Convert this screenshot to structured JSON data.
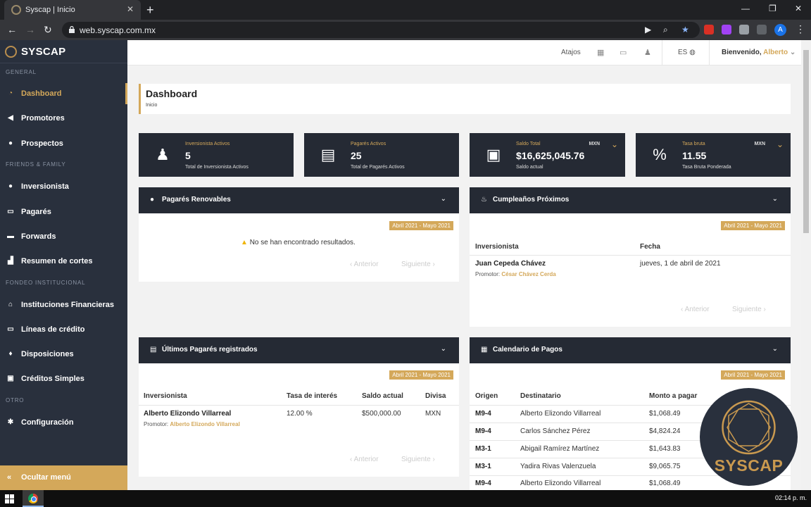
{
  "browser": {
    "tab_title": "Syscap | Inicio",
    "url": "web.syscap.com.mx",
    "profile_initial": "A"
  },
  "sidebar": {
    "brand": "SYSCAP",
    "sections": {
      "general": "GENERAL",
      "friends": "FRIENDS & FAMILY",
      "fondeo": "FONDEO INSTITUCIONAL",
      "otro": "OTRO"
    },
    "items": {
      "dashboard": "Dashboard",
      "promotores": "Promotores",
      "prospectos": "Prospectos",
      "inversionista": "Inversionista",
      "pagares": "Pagarés",
      "forwards": "Forwards",
      "resumen": "Resumen de cortes",
      "instituciones": "Instituciones Financieras",
      "lineas": "Líneas de crédito",
      "disposiciones": "Disposiciones",
      "creditos": "Créditos Simples",
      "configuracion": "Configuración"
    },
    "hide_menu": "Ocultar menú"
  },
  "header": {
    "atajos": "Atajos",
    "lang": "ES",
    "welcome": "Bienvenido,",
    "user": "Alberto"
  },
  "page": {
    "title": "Dashboard",
    "breadcrumb": "Inicio"
  },
  "stats": [
    {
      "label": "Inversionista Activos",
      "value": "5",
      "sub": "Total de Inversionista Activos"
    },
    {
      "label": "Pagarés Activos",
      "value": "25",
      "sub": "Total de Pagarés Activos"
    },
    {
      "label": "Saldo Total",
      "value": "$16,625,045.76",
      "sub": "Saldo actual",
      "currency": "MXN"
    },
    {
      "label": "Tasa bruta",
      "value": "11.55",
      "sub": "Tasa Bruta Ponderada",
      "currency": "MXN"
    }
  ],
  "renovables": {
    "title": "Pagarés Renovables",
    "range": "Abril 2021 - Mayo 2021",
    "empty": "No se han encontrado resultados.",
    "prev": "Anterior",
    "next": "Siguiente"
  },
  "cumples": {
    "title": "Cumpleaños Próximos",
    "range": "Abril 2021 - Mayo 2021",
    "headers": {
      "inv": "Inversionista",
      "fecha": "Fecha"
    },
    "row": {
      "name": "Juan Cepeda Chávez",
      "promotor_label": "Promotor:",
      "promotor": "César Chávez Cerda",
      "fecha": "jueves, 1 de abril de 2021"
    },
    "prev": "Anterior",
    "next": "Siguiente"
  },
  "ultimos": {
    "title": "Últimos Pagarés registrados",
    "range": "Abril 2021 - Mayo 2021",
    "headers": {
      "inv": "Inversionista",
      "tasa": "Tasa de interés",
      "saldo": "Saldo actual",
      "divisa": "Divisa"
    },
    "row": {
      "name": "Alberto Elizondo Villarreal",
      "promotor_label": "Promotor:",
      "promotor": "Alberto Elizondo Villarreal",
      "tasa": "12.00 %",
      "saldo": "$500,000.00",
      "divisa": "MXN"
    },
    "prev": "Anterior",
    "next": "Siguiente"
  },
  "calendario": {
    "title": "Calendario de Pagos",
    "range": "Abril 2021 - Mayo 2021",
    "headers": {
      "origen": "Origen",
      "dest": "Destinatario",
      "monto": "Monto a pagar"
    },
    "rows": [
      {
        "origen": "M9-4",
        "dest": "Alberto Elizondo Villarreal",
        "monto": "$1,068.49"
      },
      {
        "origen": "M9-4",
        "dest": "Carlos Sánchez Pérez",
        "monto": "$4,824.24"
      },
      {
        "origen": "M3-1",
        "dest": "Abigail Ramírez Martínez",
        "monto": "$1,643.83"
      },
      {
        "origen": "M3-1",
        "dest": "Yadira Rivas Valenzuela",
        "monto": "$9,065.75"
      },
      {
        "origen": "M9-4",
        "dest": "Alberto Elizondo Villarreal",
        "monto": "$1,068.49"
      }
    ]
  },
  "watermark": "SYSCAP",
  "taskbar": {
    "clock": "02:14 p. m."
  }
}
